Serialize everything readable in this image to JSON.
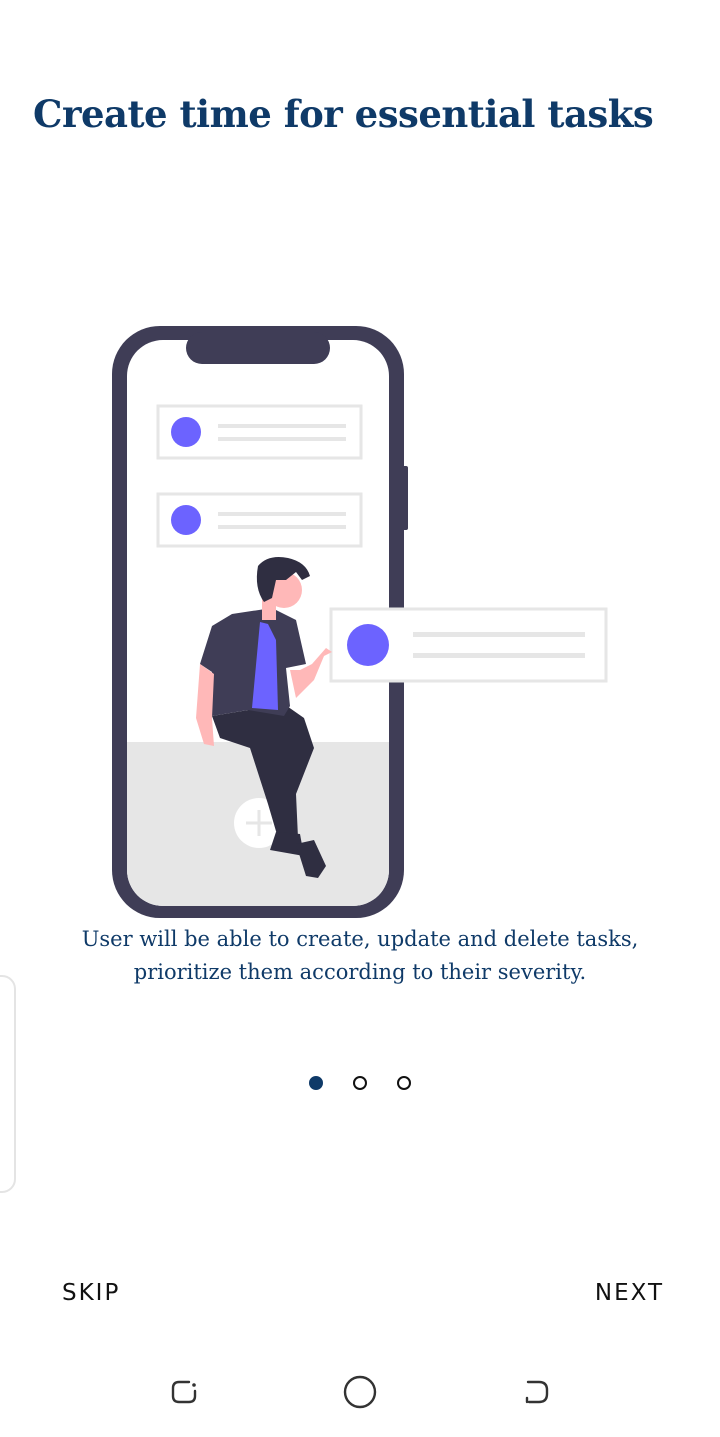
{
  "onboarding": {
    "title": "Create time for essential tasks",
    "description": "User will be able to create, update and delete tasks, prioritize them according to their severity.",
    "page_indicator": {
      "current": 1,
      "total": 3
    }
  },
  "actions": {
    "skip_label": "SKIP",
    "next_label": "NEXT"
  },
  "colors": {
    "title": "#0f3a68",
    "accent": "#6c63ff",
    "phone_frame": "#3f3d56",
    "active_dot": "#0f3a68"
  },
  "system_nav": {
    "icons": [
      "recent-apps-icon",
      "home-icon",
      "back-icon"
    ]
  }
}
